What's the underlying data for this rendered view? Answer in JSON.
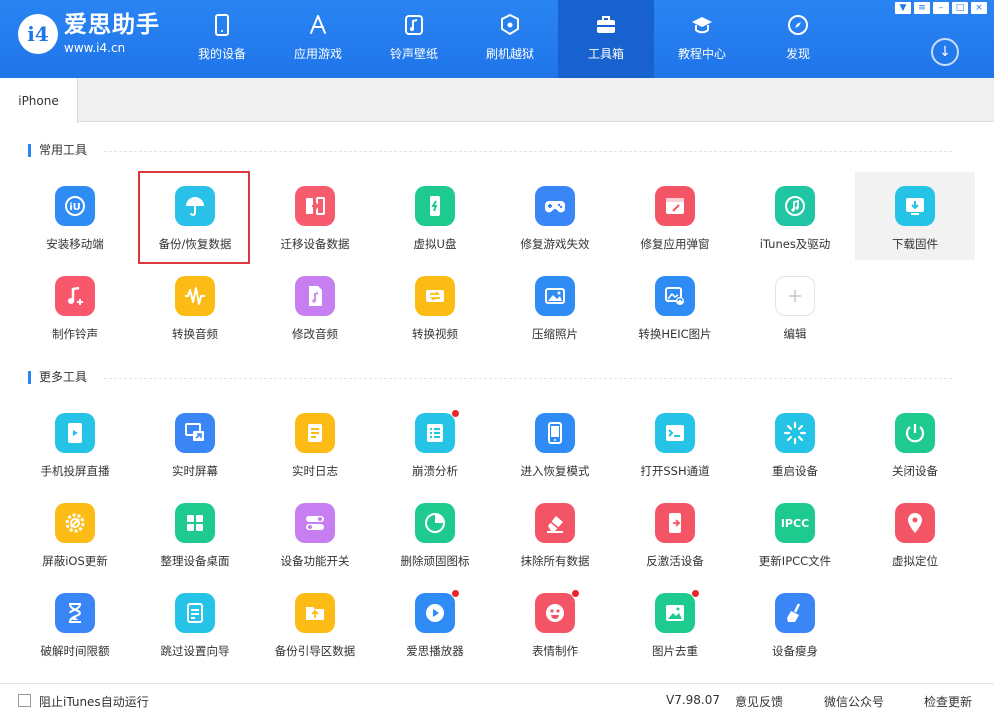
{
  "app": {
    "name": "爱思助手",
    "url": "www.i4.cn",
    "logo_mark": "i4"
  },
  "nav": [
    {
      "label": "我的设备",
      "icon": "phone-icon"
    },
    {
      "label": "应用游戏",
      "icon": "appstore-icon"
    },
    {
      "label": "铃声壁纸",
      "icon": "music-note-icon"
    },
    {
      "label": "刷机越狱",
      "icon": "box-icon"
    },
    {
      "label": "工具箱",
      "icon": "toolbox-icon",
      "active": true
    },
    {
      "label": "教程中心",
      "icon": "graduation-cap-icon"
    },
    {
      "label": "发现",
      "icon": "compass-icon"
    }
  ],
  "window_controls": [
    "shirt-icon",
    "menu-icon",
    "minimize-icon",
    "maximize-icon",
    "close-icon"
  ],
  "tabs": [
    {
      "label": "iPhone",
      "active": true
    }
  ],
  "sections": [
    {
      "title": "常用工具",
      "tools": [
        {
          "label": "安装移动端",
          "icon": "i4-app-icon",
          "color": "#2f8cf4"
        },
        {
          "label": "备份/恢复数据",
          "icon": "umbrella-icon",
          "color": "#29c1e8",
          "selected": true
        },
        {
          "label": "迁移设备数据",
          "icon": "transfer-icon",
          "color": "#f75c6e"
        },
        {
          "label": "虚拟U盘",
          "icon": "usb-drive-icon",
          "color": "#1fca8f"
        },
        {
          "label": "修复游戏失效",
          "icon": "gamepad-icon",
          "color": "#3a86f6"
        },
        {
          "label": "修复应用弹窗",
          "icon": "repair-window-icon",
          "color": "#f35566"
        },
        {
          "label": "iTunes及驱动",
          "icon": "itunes-icon",
          "color": "#20c5a3"
        },
        {
          "label": "下载固件",
          "icon": "download-firmware-icon",
          "color": "#25c3e6",
          "highlight": true
        },
        {
          "label": "制作铃声",
          "icon": "ringtone-icon",
          "color": "#f8576c"
        },
        {
          "label": "转换音频",
          "icon": "waveform-icon",
          "color": "#fdbb16"
        },
        {
          "label": "修改音频",
          "icon": "audio-file-icon",
          "color": "#c77ef0"
        },
        {
          "label": "转换视频",
          "icon": "video-convert-icon",
          "color": "#fdbb16"
        },
        {
          "label": "压缩照片",
          "icon": "photo-icon",
          "color": "#2f8cf4"
        },
        {
          "label": "转换HEIC图片",
          "icon": "heic-convert-icon",
          "color": "#2f8cf4"
        },
        {
          "label": "编辑",
          "icon": "plus-icon",
          "color": "#ffffff",
          "add": true
        }
      ]
    },
    {
      "title": "更多工具",
      "tools": [
        {
          "label": "手机投屏直播",
          "icon": "screen-cast-icon",
          "color": "#25c3e6"
        },
        {
          "label": "实时屏幕",
          "icon": "realtime-screen-icon",
          "color": "#3a86f6"
        },
        {
          "label": "实时日志",
          "icon": "log-icon",
          "color": "#fdbb16"
        },
        {
          "label": "崩溃分析",
          "icon": "crash-report-icon",
          "color": "#25c3e6",
          "dot": true
        },
        {
          "label": "进入恢复模式",
          "icon": "recovery-phone-icon",
          "color": "#2f8cf4"
        },
        {
          "label": "打开SSH通道",
          "icon": "terminal-icon",
          "color": "#25c3e6"
        },
        {
          "label": "重启设备",
          "icon": "restart-icon",
          "color": "#25c3e6"
        },
        {
          "label": "关闭设备",
          "icon": "power-icon",
          "color": "#1fca8f"
        },
        {
          "label": "屏蔽iOS更新",
          "icon": "gear-icon",
          "color": "#fdbb16"
        },
        {
          "label": "整理设备桌面",
          "icon": "grid-icon",
          "color": "#1fca8f"
        },
        {
          "label": "设备功能开关",
          "icon": "toggle-icon",
          "color": "#c77ef0"
        },
        {
          "label": "删除顽固图标",
          "icon": "pie-icon",
          "color": "#1fca8f"
        },
        {
          "label": "抹除所有数据",
          "icon": "eraser-icon",
          "color": "#f35566"
        },
        {
          "label": "反激活设备",
          "icon": "deactivate-icon",
          "color": "#f35566"
        },
        {
          "label": "更新IPCC文件",
          "icon": "ipcc-icon",
          "color": "#1fca8f",
          "text_icon": "IPCC"
        },
        {
          "label": "虚拟定位",
          "icon": "location-pin-icon",
          "color": "#f35566"
        },
        {
          "label": "破解时间限额",
          "icon": "hourglass-icon",
          "color": "#3a86f6"
        },
        {
          "label": "跳过设置向导",
          "icon": "skip-setup-icon",
          "color": "#25c3e6"
        },
        {
          "label": "备份引导区数据",
          "icon": "folder-backup-icon",
          "color": "#fdbb16"
        },
        {
          "label": "爱思播放器",
          "icon": "play-icon",
          "color": "#2f8cf4",
          "dot": true
        },
        {
          "label": "表情制作",
          "icon": "emoji-icon",
          "color": "#f35566",
          "dot": true
        },
        {
          "label": "图片去重",
          "icon": "image-dedup-icon",
          "color": "#1fca8f",
          "dot": true
        },
        {
          "label": "设备瘦身",
          "icon": "broom-icon",
          "color": "#3a86f6"
        }
      ]
    }
  ],
  "footer": {
    "itunes_autorun_label": "阻止iTunes自动运行",
    "version": "V7.98.07",
    "feedback": "意见反馈",
    "wechat": "微信公众号",
    "check_update": "检查更新"
  }
}
